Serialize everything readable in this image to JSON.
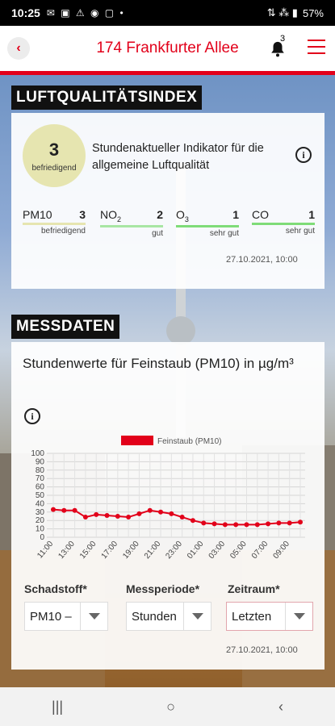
{
  "status_bar": {
    "time": "10:25",
    "left_icons": "✉ ▣ ⚠ ◉ ▢ •",
    "right_icons": "⇅ ⁂ ▮",
    "battery": "57%"
  },
  "app_bar": {
    "title": "174 Frankfurter Allee",
    "notification_count": "3"
  },
  "aqi_section": {
    "label": "LUFTQUALITÄTSINDEX",
    "index_value": "3",
    "index_status": "befriedigend",
    "description": "Stundenaktueller Indikator für die allgemeine Luftqualität",
    "pollutants": [
      {
        "name": "PM10",
        "sub": "",
        "value": "3",
        "status": "befriedigend",
        "color": "#e6e5b0"
      },
      {
        "name": "NO",
        "sub": "2",
        "value": "2",
        "status": "gut",
        "color": "#a8e6a3"
      },
      {
        "name": "O",
        "sub": "3",
        "value": "1",
        "status": "sehr gut",
        "color": "#7fdc78"
      },
      {
        "name": "CO",
        "sub": "",
        "value": "1",
        "status": "sehr gut",
        "color": "#7fdc78"
      }
    ],
    "timestamp": "27.10.2021, 10:00"
  },
  "measure_section": {
    "label": "MESSDATEN",
    "chart_title": "Stundenwerte für Feinstaub (PM10) in µg/m³",
    "filters": {
      "pollutant_label": "Schadstoff*",
      "pollutant_value": "PM10 – ",
      "period_label": "Messperiode*",
      "period_value": "Stunden",
      "range_label": "Zeitraum*",
      "range_value": "Letzten"
    },
    "timestamp": "27.10.2021, 10:00"
  },
  "chart_data": {
    "type": "line",
    "legend": [
      "Feinstaub (PM10)"
    ],
    "series": [
      {
        "name": "Feinstaub (PM10)",
        "color": "#e2001a",
        "values": [
          33,
          32,
          32,
          24,
          27,
          26,
          25,
          24,
          28,
          32,
          30,
          28,
          24,
          20,
          17,
          16,
          15,
          15,
          15,
          15,
          16,
          17,
          17,
          18
        ]
      }
    ],
    "x": [
      "11:00",
      "12:00",
      "13:00",
      "14:00",
      "15:00",
      "16:00",
      "17:00",
      "18:00",
      "19:00",
      "20:00",
      "21:00",
      "22:00",
      "23:00",
      "00:00",
      "01:00",
      "02:00",
      "03:00",
      "04:00",
      "05:00",
      "06:00",
      "07:00",
      "08:00",
      "09:00",
      "10:00"
    ],
    "x_tick_labels": [
      "11:00",
      "13:00",
      "15:00",
      "17:00",
      "19:00",
      "21:00",
      "23:00",
      "01:00",
      "03:00",
      "05:00",
      "07:00",
      "09:00"
    ],
    "y_ticks": [
      0,
      10,
      20,
      30,
      40,
      50,
      60,
      70,
      80,
      90,
      100
    ],
    "ylim": [
      0,
      100
    ],
    "grid": true,
    "legend_position": "top-center"
  },
  "nav_bar": {
    "recents": "|||",
    "home": "○",
    "back": "‹"
  }
}
